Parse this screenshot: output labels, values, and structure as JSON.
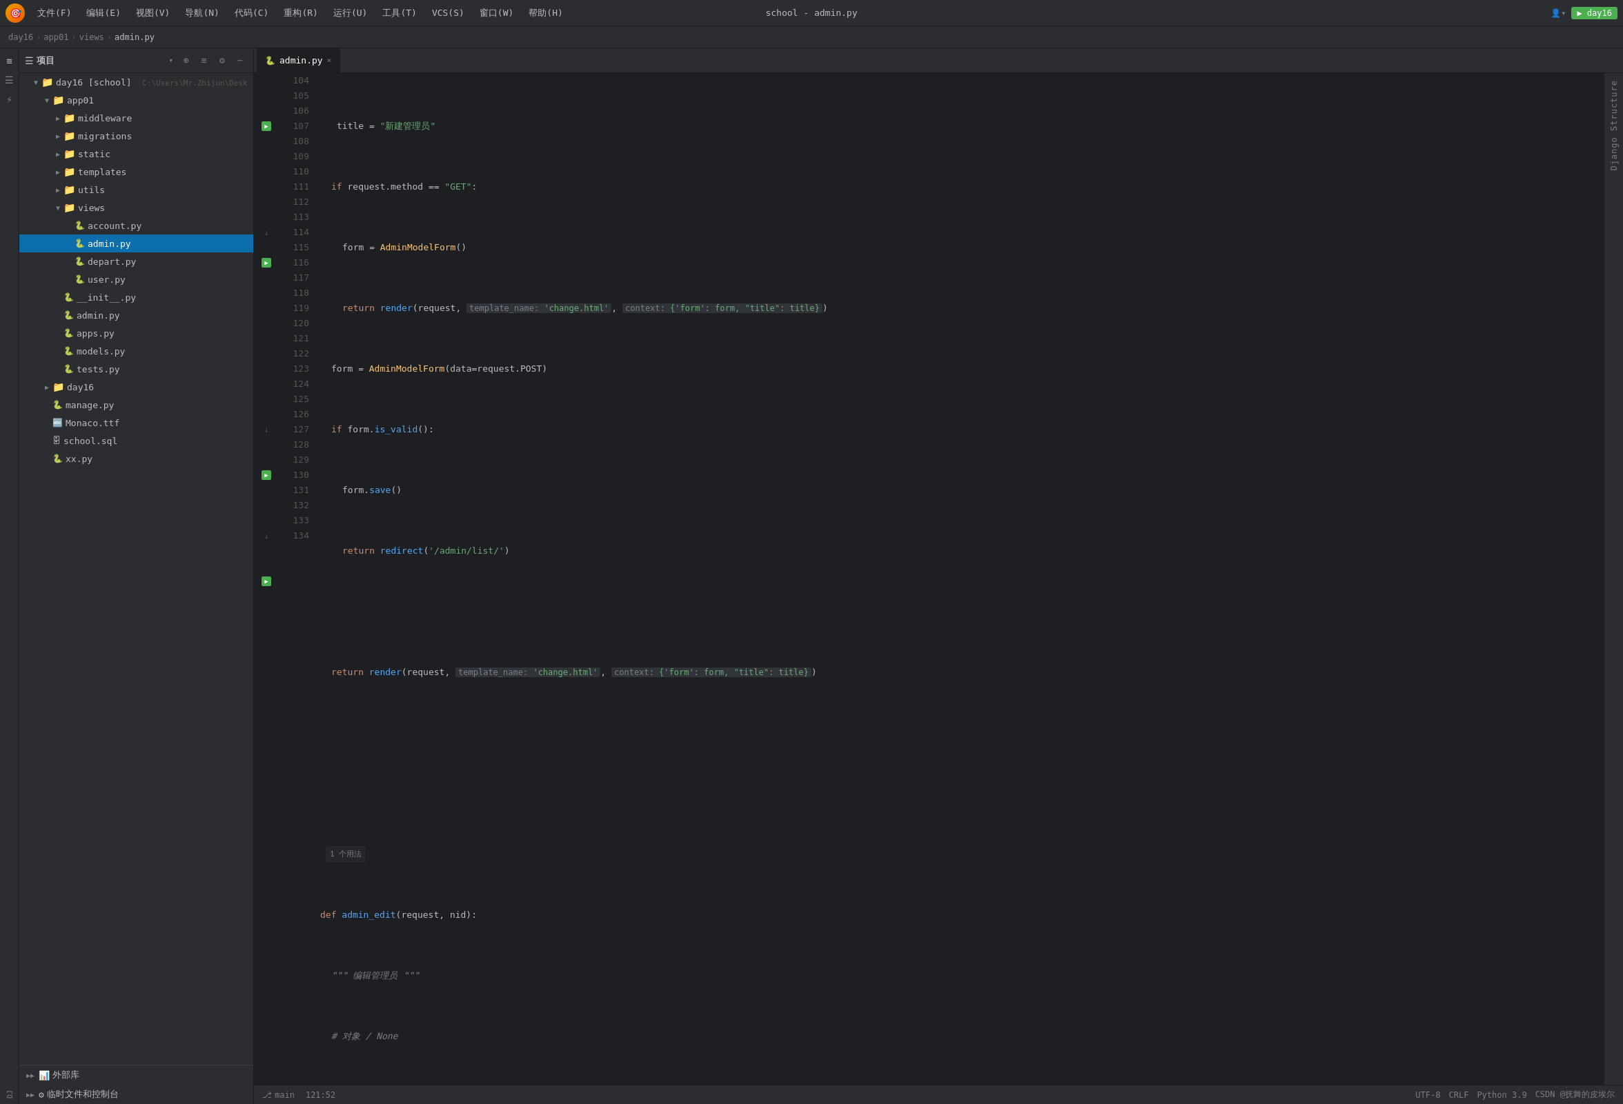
{
  "window": {
    "title": "school - admin.py",
    "logo": "🎯"
  },
  "menubar": {
    "items": [
      "文件(F)",
      "编辑(E)",
      "视图(V)",
      "导航(N)",
      "代码(C)",
      "重构(R)",
      "运行(U)",
      "工具(T)",
      "VCS(S)",
      "窗口(W)",
      "帮助(H)"
    ]
  },
  "breadcrumb": {
    "items": [
      "day16",
      "app01",
      "views",
      "admin.py"
    ]
  },
  "sidebar": {
    "title": "项目",
    "root": "day16 [school]",
    "path": "C:\\Users\\Mr.Zhijun\\Desk"
  },
  "editor": {
    "tab": "admin.py"
  },
  "django_panel_label": "Django Structure",
  "statusbar": {
    "right": "CSDN @抚舞的皮埃尔"
  }
}
